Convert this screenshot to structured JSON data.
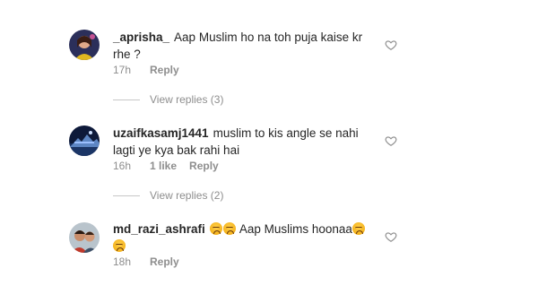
{
  "comments": [
    {
      "username": "_aprisha_",
      "text": "Aap Muslim ho na toh puja kaise kr rhe ?",
      "time": "17h",
      "likes": "",
      "reply_label": "Reply",
      "view_replies": "View replies (3)"
    },
    {
      "username": "uzaifkasamj1441",
      "text": "muslim to kis angle se nahi lagti ye kya bak rahi hai",
      "time": "16h",
      "likes": "1 like",
      "reply_label": "Reply",
      "view_replies": "View replies (2)"
    },
    {
      "username": "md_razi_ashrafi",
      "text_before": "",
      "text": "Aap Muslims hoonaa",
      "time": "18h",
      "likes": "",
      "reply_label": "Reply"
    }
  ],
  "icons": {
    "like": "heart-outline-icon",
    "emoji": "persevering-face-emoji"
  },
  "colors": {
    "text": "#262626",
    "secondary": "#8e8e8e",
    "divider": "#c7c7c7"
  }
}
